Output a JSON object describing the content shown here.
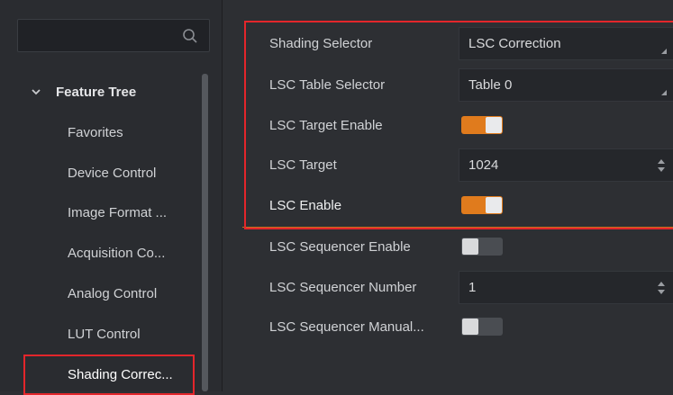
{
  "sidebar": {
    "search": {
      "placeholder": "",
      "icon": "search-icon"
    },
    "tree_title": "Feature Tree",
    "items": [
      {
        "label": "Favorites"
      },
      {
        "label": "Device Control"
      },
      {
        "label": "Image Format ..."
      },
      {
        "label": "Acquisition Co..."
      },
      {
        "label": "Analog Control"
      },
      {
        "label": "LUT Control"
      },
      {
        "label": "Shading Correc..."
      }
    ]
  },
  "properties": [
    {
      "label": "Shading Selector",
      "type": "dropdown",
      "value": "LSC Correction"
    },
    {
      "label": "LSC Table Selector",
      "type": "dropdown",
      "value": "Table 0"
    },
    {
      "label": "LSC Target Enable",
      "type": "toggle",
      "value": "on"
    },
    {
      "label": "LSC Target",
      "type": "number",
      "value": "1024"
    },
    {
      "label": "LSC Enable",
      "type": "toggle",
      "value": "on"
    },
    {
      "label": "LSC Sequencer Enable",
      "type": "toggle",
      "value": "off"
    },
    {
      "label": "LSC Sequencer Number",
      "type": "number",
      "value": "1"
    },
    {
      "label": "LSC Sequencer Manual...",
      "type": "toggle",
      "value": "off"
    }
  ],
  "colors": {
    "accent": "#e07b1d",
    "highlight": "#e3262b",
    "background": "#2d2f33"
  }
}
